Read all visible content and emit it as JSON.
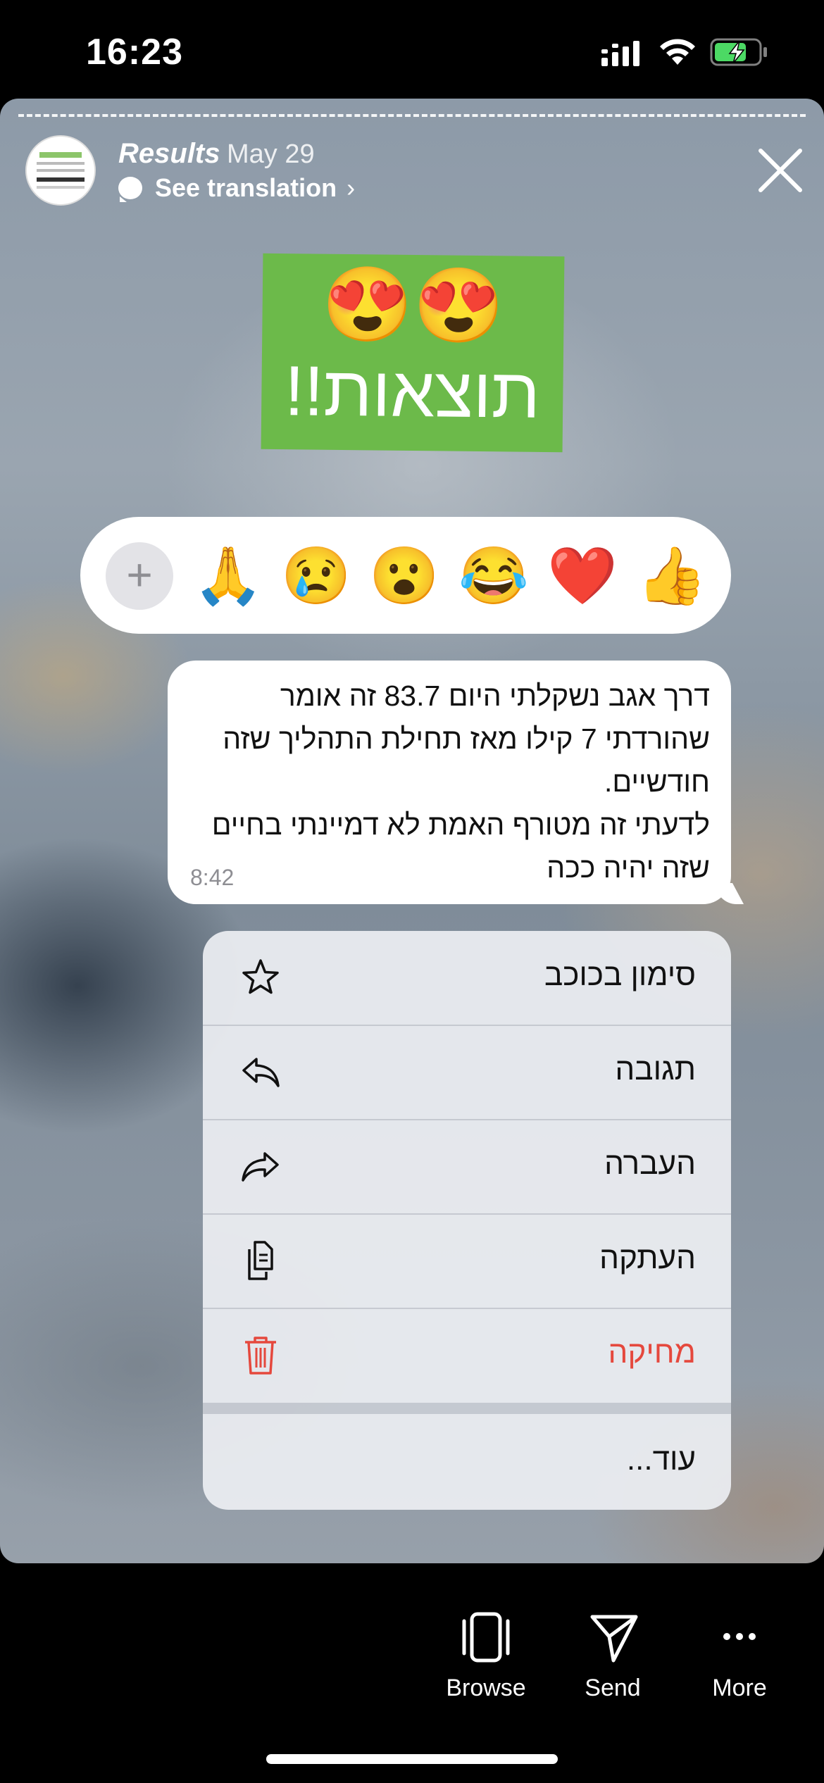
{
  "status_bar": {
    "time": "16:23"
  },
  "story": {
    "username": "Results",
    "date": "May 29",
    "see_translation": "See translation",
    "image_emojis": "😍😍",
    "image_text": "תוצאות!!"
  },
  "reactions": {
    "add_label": "+",
    "items": [
      "🙏",
      "😢",
      "😮",
      "😂",
      "❤️",
      "👍"
    ]
  },
  "message": {
    "text": "דרך אגב נשקלתי היום 83.7 זה אומר שהורדתי 7 קילו מאז תחילת התהליך שזה חודשיים.\nלדעתי זה מטורף האמת לא דמיינתי בחיים שזה יהיה ככה",
    "time": "8:42"
  },
  "menu": {
    "items": [
      {
        "label": "סימון בכוכב",
        "icon": "star-icon"
      },
      {
        "label": "תגובה",
        "icon": "reply-icon"
      },
      {
        "label": "העברה",
        "icon": "forward-icon"
      },
      {
        "label": "העתקה",
        "icon": "copy-icon"
      },
      {
        "label": "מחיקה",
        "icon": "trash-icon",
        "color": "#e5483d"
      }
    ],
    "more_label": "עוד..."
  },
  "bottom_bar": {
    "browse": "Browse",
    "send": "Send",
    "more": "More"
  },
  "colors": {
    "green_card": "#6cba4a",
    "destructive": "#e5483d",
    "battery_charge": "#4cd964"
  }
}
